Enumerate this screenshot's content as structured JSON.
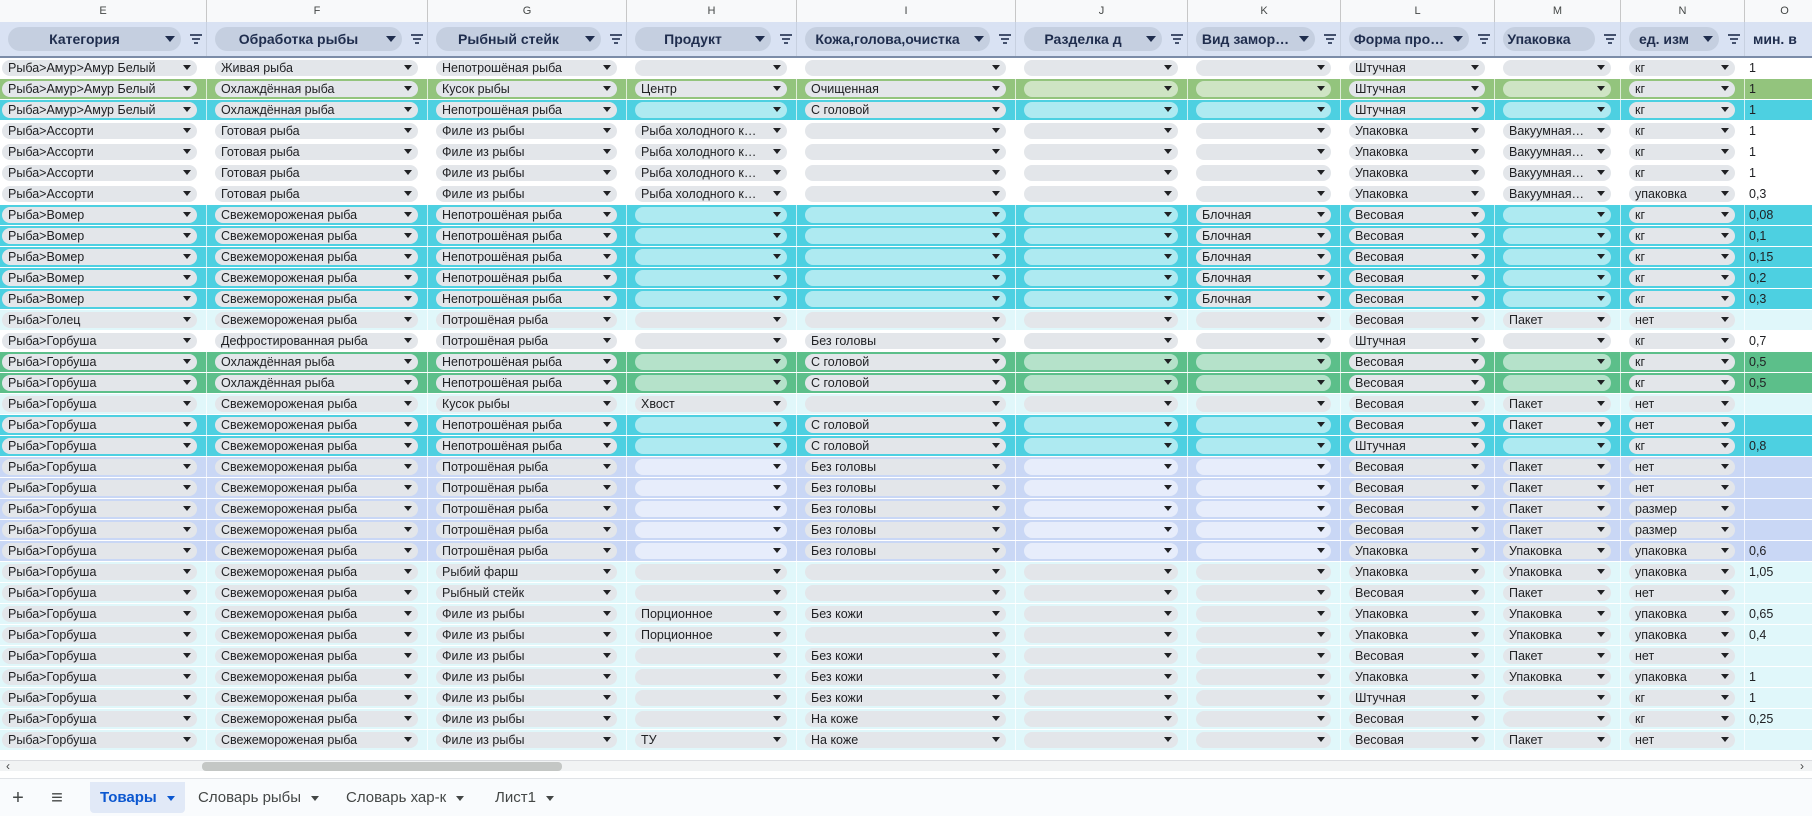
{
  "sheet": {
    "column_letters": [
      "E",
      "F",
      "G",
      "H",
      "I",
      "J",
      "K",
      "L",
      "M",
      "N",
      "O"
    ],
    "headers": [
      "Категория",
      "Обработка рыбы",
      "Рыбный стейк",
      "Продукт",
      "Кожа,голова,очистка",
      "Разделка д",
      "Вид замор…",
      "Форма про…",
      "Упаковка",
      "ед. изм",
      "мин. в"
    ],
    "row_colors": {
      "white": "#ffffff",
      "green": "#93c47d",
      "cyan": "#4dd0e1",
      "lightcyan": "#e0f7fa",
      "darkgreen": "#5cbf8a",
      "lavender": "#c9d7f5",
      "header": "#d9e2f3"
    },
    "rows": [
      {
        "bg": "white",
        "cells": [
          "Рыба>Амур>Амур Белый",
          "Живая рыба",
          "Непотрошёная рыба",
          "",
          "",
          "",
          "",
          "Штучная",
          "",
          "кг",
          "1"
        ]
      },
      {
        "bg": "green",
        "cells": [
          "Рыба>Амур>Амур Белый",
          "Охлаждённая рыба",
          "Кусок рыбы",
          "Центр",
          "Очищенная",
          "",
          "",
          "Штучная",
          "",
          "кг",
          "1"
        ]
      },
      {
        "bg": "cyan",
        "cells": [
          "Рыба>Амур>Амур Белый",
          "Охлаждённая рыба",
          "Непотрошёная рыба",
          "",
          "С головой",
          "",
          "",
          "Штучная",
          "",
          "кг",
          "1"
        ]
      },
      {
        "bg": "white",
        "cells": [
          "Рыба>Ассорти",
          "Готовая рыба",
          "Филе из рыбы",
          "Рыба холодного к…",
          "",
          "",
          "",
          "Упаковка",
          "Вакуумная…",
          "кг",
          "1"
        ]
      },
      {
        "bg": "white",
        "cells": [
          "Рыба>Ассорти",
          "Готовая рыба",
          "Филе из рыбы",
          "Рыба холодного к…",
          "",
          "",
          "",
          "Упаковка",
          "Вакуумная…",
          "кг",
          "1"
        ]
      },
      {
        "bg": "white",
        "cells": [
          "Рыба>Ассорти",
          "Готовая рыба",
          "Филе из рыбы",
          "Рыба холодного к…",
          "",
          "",
          "",
          "Упаковка",
          "Вакуумная…",
          "кг",
          "1"
        ]
      },
      {
        "bg": "white",
        "cells": [
          "Рыба>Ассорти",
          "Готовая рыба",
          "Филе из рыбы",
          "Рыба холодного к…",
          "",
          "",
          "",
          "Упаковка",
          "Вакуумная…",
          "упаковка",
          "0,3"
        ]
      },
      {
        "bg": "cyan",
        "cells": [
          "Рыба>Вомер",
          "Свежемороженая рыба",
          "Непотрошёная рыба",
          "",
          "",
          "",
          "Блочная",
          "Весовая",
          "",
          "кг",
          "0,08"
        ]
      },
      {
        "bg": "cyan",
        "cells": [
          "Рыба>Вомер",
          "Свежемороженая рыба",
          "Непотрошёная рыба",
          "",
          "",
          "",
          "Блочная",
          "Весовая",
          "",
          "кг",
          "0,1"
        ]
      },
      {
        "bg": "cyan",
        "cells": [
          "Рыба>Вомер",
          "Свежемороженая рыба",
          "Непотрошёная рыба",
          "",
          "",
          "",
          "Блочная",
          "Весовая",
          "",
          "кг",
          "0,15"
        ]
      },
      {
        "bg": "cyan",
        "cells": [
          "Рыба>Вомер",
          "Свежемороженая рыба",
          "Непотрошёная рыба",
          "",
          "",
          "",
          "Блочная",
          "Весовая",
          "",
          "кг",
          "0,2"
        ]
      },
      {
        "bg": "cyan",
        "cells": [
          "Рыба>Вомер",
          "Свежемороженая рыба",
          "Непотрошёная рыба",
          "",
          "",
          "",
          "Блочная",
          "Весовая",
          "",
          "кг",
          "0,3"
        ]
      },
      {
        "bg": "lightcyan",
        "cells": [
          "Рыба>Голец",
          "Свежемороженая рыба",
          "Потрошёная рыба",
          "",
          "",
          "",
          "",
          "Весовая",
          "Пакет",
          "нет",
          ""
        ]
      },
      {
        "bg": "white",
        "cells": [
          "Рыба>Горбуша",
          "Дефростированная рыба",
          "Потрошёная рыба",
          "",
          "Без головы",
          "",
          "",
          "Штучная",
          "",
          "кг",
          "0,7"
        ]
      },
      {
        "bg": "darkgreen",
        "cells": [
          "Рыба>Горбуша",
          "Охлаждённая рыба",
          "Непотрошёная рыба",
          "",
          "С головой",
          "",
          "",
          "Весовая",
          "",
          "кг",
          "0,5"
        ]
      },
      {
        "bg": "darkgreen",
        "cells": [
          "Рыба>Горбуша",
          "Охлаждённая рыба",
          "Непотрошёная рыба",
          "",
          "С головой",
          "",
          "",
          "Весовая",
          "",
          "кг",
          "0,5"
        ]
      },
      {
        "bg": "lightcyan",
        "cells": [
          "Рыба>Горбуша",
          "Свежемороженая рыба",
          "Кусок рыбы",
          "Хвост",
          "",
          "",
          "",
          "Весовая",
          "Пакет",
          "нет",
          ""
        ]
      },
      {
        "bg": "cyan",
        "cells": [
          "Рыба>Горбуша",
          "Свежемороженая рыба",
          "Непотрошёная рыба",
          "",
          "С головой",
          "",
          "",
          "Весовая",
          "Пакет",
          "нет",
          ""
        ]
      },
      {
        "bg": "cyan",
        "cells": [
          "Рыба>Горбуша",
          "Свежемороженая рыба",
          "Непотрошёная рыба",
          "",
          "С головой",
          "",
          "",
          "Штучная",
          "",
          "кг",
          "0,8"
        ]
      },
      {
        "bg": "lavender",
        "cells": [
          "Рыба>Горбуша",
          "Свежемороженая рыба",
          "Потрошёная рыба",
          "",
          "Без головы",
          "",
          "",
          "Весовая",
          "Пакет",
          "нет",
          ""
        ]
      },
      {
        "bg": "lavender",
        "cells": [
          "Рыба>Горбуша",
          "Свежемороженая рыба",
          "Потрошёная рыба",
          "",
          "Без головы",
          "",
          "",
          "Весовая",
          "Пакет",
          "нет",
          ""
        ]
      },
      {
        "bg": "lavender",
        "cells": [
          "Рыба>Горбуша",
          "Свежемороженая рыба",
          "Потрошёная рыба",
          "",
          "Без головы",
          "",
          "",
          "Весовая",
          "Пакет",
          "размер",
          ""
        ]
      },
      {
        "bg": "lavender",
        "cells": [
          "Рыба>Горбуша",
          "Свежемороженая рыба",
          "Потрошёная рыба",
          "",
          "Без головы",
          "",
          "",
          "Весовая",
          "Пакет",
          "размер",
          ""
        ]
      },
      {
        "bg": "lavender",
        "cells": [
          "Рыба>Горбуша",
          "Свежемороженая рыба",
          "Потрошёная рыба",
          "",
          "Без головы",
          "",
          "",
          "Упаковка",
          "Упаковка",
          "упаковка",
          "0,6"
        ]
      },
      {
        "bg": "lightcyan",
        "cells": [
          "Рыба>Горбуша",
          "Свежемороженая рыба",
          "Рыбий фарш",
          "",
          "",
          "",
          "",
          "Упаковка",
          "Упаковка",
          "упаковка",
          "1,05"
        ]
      },
      {
        "bg": "lightcyan",
        "cells": [
          "Рыба>Горбуша",
          "Свежемороженая рыба",
          "Рыбный стейк",
          "",
          "",
          "",
          "",
          "Весовая",
          "Пакет",
          "нет",
          ""
        ]
      },
      {
        "bg": "lightcyan",
        "cells": [
          "Рыба>Горбуша",
          "Свежемороженая рыба",
          "Филе из рыбы",
          "Порционное",
          "Без кожи",
          "",
          "",
          "Упаковка",
          "Упаковка",
          "упаковка",
          "0,65"
        ]
      },
      {
        "bg": "lightcyan",
        "cells": [
          "Рыба>Горбуша",
          "Свежемороженая рыба",
          "Филе из рыбы",
          "Порционное",
          "",
          "",
          "",
          "Упаковка",
          "Упаковка",
          "упаковка",
          "0,4"
        ]
      },
      {
        "bg": "lightcyan",
        "cells": [
          "Рыба>Горбуша",
          "Свежемороженая рыба",
          "Филе из рыбы",
          "",
          "Без кожи",
          "",
          "",
          "Весовая",
          "Пакет",
          "нет",
          ""
        ]
      },
      {
        "bg": "lightcyan",
        "cells": [
          "Рыба>Горбуша",
          "Свежемороженая рыба",
          "Филе из рыбы",
          "",
          "Без кожи",
          "",
          "",
          "Упаковка",
          "Упаковка",
          "упаковка",
          "1"
        ]
      },
      {
        "bg": "lightcyan",
        "cells": [
          "Рыба>Горбуша",
          "Свежемороженая рыба",
          "Филе из рыбы",
          "",
          "Без кожи",
          "",
          "",
          "Штучная",
          "",
          "кг",
          "1"
        ]
      },
      {
        "bg": "lightcyan",
        "cells": [
          "Рыба>Горбуша",
          "Свежемороженая рыба",
          "Филе из рыбы",
          "",
          "На коже",
          "",
          "",
          "Весовая",
          "",
          "кг",
          "0,25"
        ]
      },
      {
        "bg": "lightcyan",
        "cells": [
          "Рыба>Горбуша",
          "Свежемороженая рыба",
          "Филе из рыбы",
          "ТУ",
          "На коже",
          "",
          "",
          "Весовая",
          "Пакет",
          "нет",
          ""
        ]
      }
    ]
  },
  "scrollbar": {
    "left_arrow": "‹",
    "right_arrow": "›"
  },
  "tabs": {
    "add_icon": "+",
    "menu_icon": "≡",
    "items": [
      {
        "label": "Товары",
        "active": true
      },
      {
        "label": "Словарь рыбы",
        "active": false
      },
      {
        "label": "Словарь хар-к",
        "active": false
      },
      {
        "label": "Лист1",
        "active": false
      }
    ]
  }
}
